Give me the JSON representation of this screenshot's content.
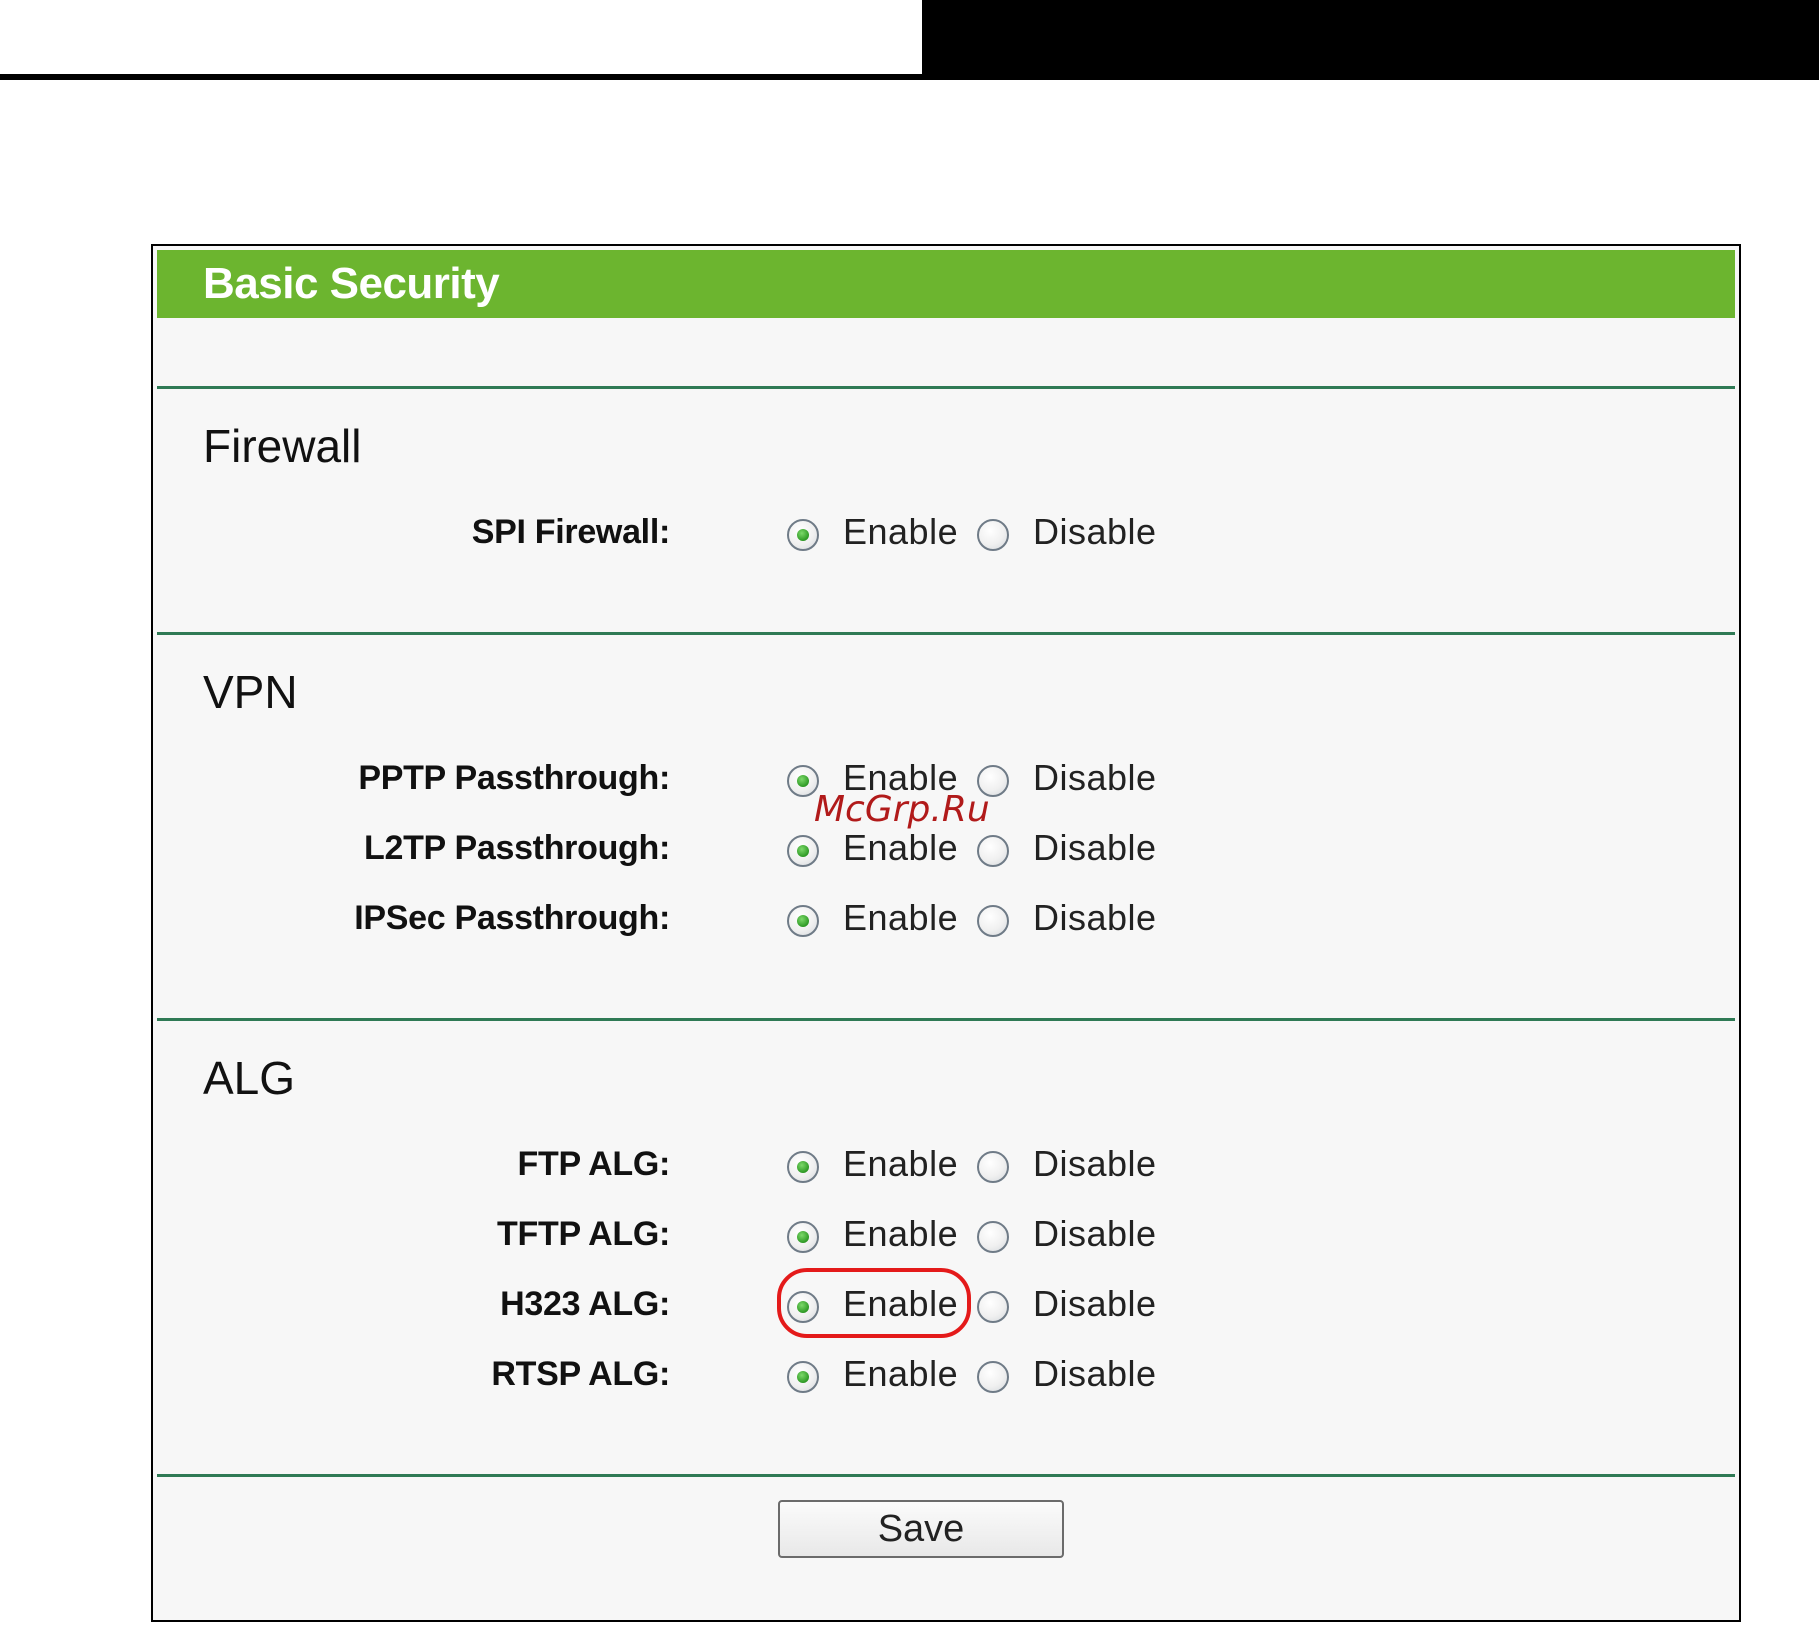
{
  "panel": {
    "title": "Basic Security"
  },
  "sections": {
    "firewall": {
      "title": "Firewall",
      "rows": [
        {
          "label": "SPI Firewall:",
          "enable": "Enable",
          "disable": "Disable",
          "selected": "Enable"
        }
      ]
    },
    "vpn": {
      "title": "VPN",
      "rows": [
        {
          "label": "PPTP Passthrough:",
          "enable": "Enable",
          "disable": "Disable",
          "selected": "Enable"
        },
        {
          "label": "L2TP Passthrough:",
          "enable": "Enable",
          "disable": "Disable",
          "selected": "Enable"
        },
        {
          "label": "IPSec Passthrough:",
          "enable": "Enable",
          "disable": "Disable",
          "selected": "Enable"
        }
      ]
    },
    "alg": {
      "title": "ALG",
      "rows": [
        {
          "label": "FTP ALG:",
          "enable": "Enable",
          "disable": "Disable",
          "selected": "Enable"
        },
        {
          "label": "TFTP ALG:",
          "enable": "Enable",
          "disable": "Disable",
          "selected": "Enable"
        },
        {
          "label": "H323 ALG:",
          "enable": "Enable",
          "disable": "Disable",
          "selected": "Enable"
        },
        {
          "label": "RTSP ALG:",
          "enable": "Enable",
          "disable": "Disable",
          "selected": "Enable"
        }
      ]
    }
  },
  "save_button": {
    "label": "Save"
  },
  "watermark": "McGrp.Ru",
  "colors": {
    "header_green": "#6cb52f",
    "divider": "#2f7a55",
    "highlight_red": "#e41a1a"
  }
}
